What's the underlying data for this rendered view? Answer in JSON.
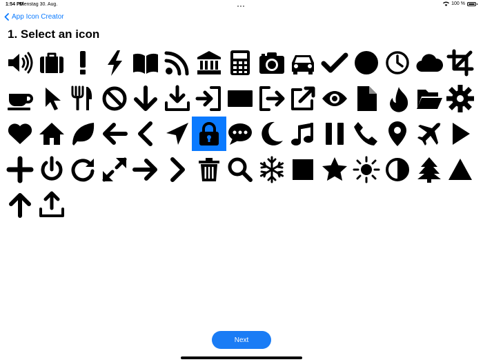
{
  "status_bar": {
    "time": "1:54 PM",
    "date": "Dienstag 30. Aug.",
    "battery": "100 %"
  },
  "nav": {
    "back_label": "App Icon Creator"
  },
  "title": "1. Select an icon",
  "icons": [
    "volume-up",
    "briefcase",
    "exclamation",
    "bolt",
    "book",
    "rss",
    "bank",
    "calculator",
    "camera",
    "car",
    "check",
    "circle",
    "clock",
    "cloud",
    "crop",
    "coffee",
    "mouse-pointer",
    "cutlery",
    "ban",
    "arrow-down",
    "download",
    "sign-in",
    "envelope",
    "sign-out",
    "external-link",
    "eye",
    "file",
    "fire",
    "folder-open",
    "gear",
    "heart",
    "home",
    "leaf",
    "arrow-left",
    "chevron-left",
    "location-arrow",
    "lock",
    "comment",
    "moon",
    "music",
    "pause",
    "phone",
    "map-marker",
    "plane",
    "play",
    "plus",
    "power-off",
    "repeat",
    "expand",
    "arrow-right",
    "chevron-right",
    "trash",
    "search",
    "snowflake",
    "square",
    "star",
    "sun",
    "adjust",
    "tree",
    "triangle",
    "arrow-up",
    "upload"
  ],
  "selected_icon": "lock",
  "colors": {
    "accent": "#0a7aff",
    "button": "#1a7cf5"
  },
  "next_button": {
    "label": "Next"
  }
}
